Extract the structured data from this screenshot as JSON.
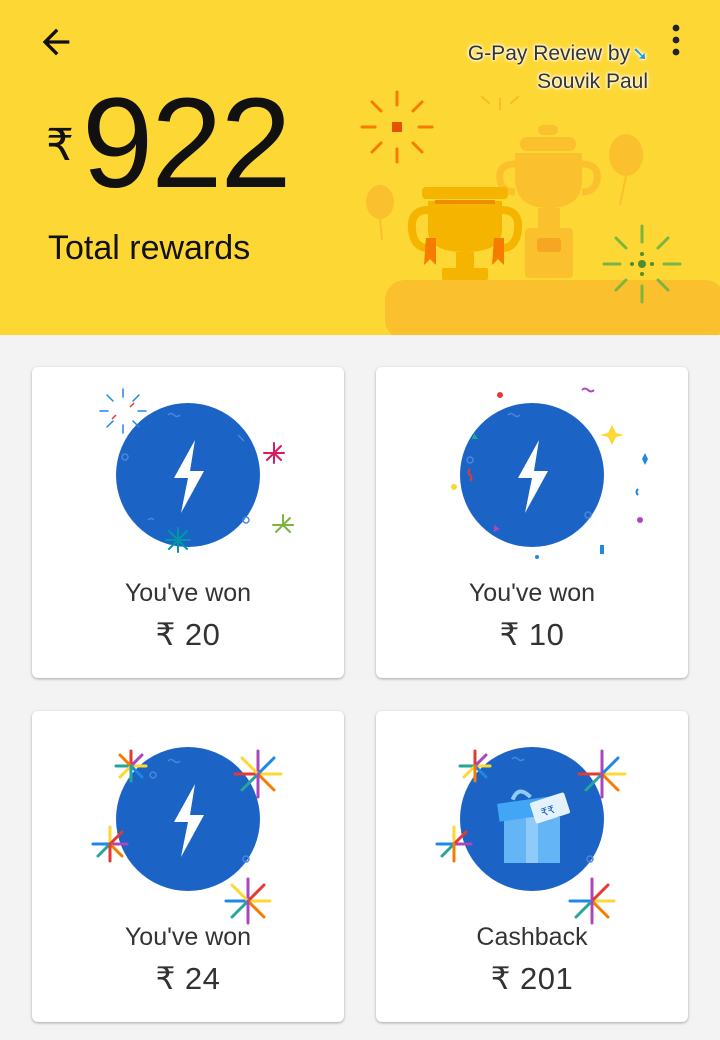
{
  "header": {
    "currency_symbol": "₹",
    "total_amount": "922",
    "total_label": "Total rewards",
    "watermark_line1": "G-Pay Review by",
    "watermark_line2": "Souvik Paul",
    "background_color": "#fdd835"
  },
  "icons": {
    "back": "arrow-left-icon",
    "more": "more-vert-icon",
    "reward": "lightning-bolt-icon",
    "cashback": "gift-box-icon"
  },
  "colors": {
    "badge_blue": "#1b63c5",
    "card_bg": "#ffffff",
    "page_bg": "#f3f3f3"
  },
  "rewards": [
    {
      "title": "You've won",
      "value": "₹ 20"
    },
    {
      "title": "You've won",
      "value": "₹ 10"
    },
    {
      "title": "You've won",
      "value": "₹ 24"
    },
    {
      "title": "Cashback",
      "value": "₹ 201"
    }
  ]
}
